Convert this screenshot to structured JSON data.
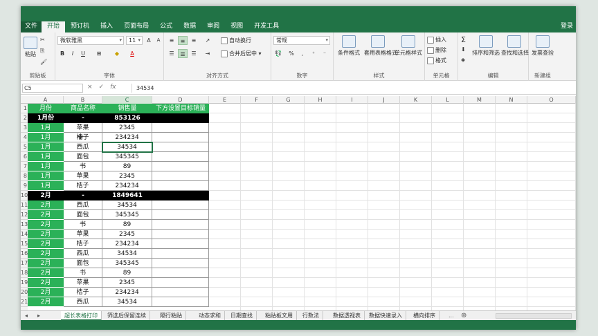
{
  "ribbon_tabs": [
    {
      "label": "文件",
      "state": "file"
    },
    {
      "label": "开始",
      "state": "active"
    },
    {
      "label": "预订机",
      "state": ""
    },
    {
      "label": "插入",
      "state": ""
    },
    {
      "label": "页面布局",
      "state": ""
    },
    {
      "label": "公式",
      "state": ""
    },
    {
      "label": "数据",
      "state": ""
    },
    {
      "label": "审阅",
      "state": ""
    },
    {
      "label": "视图",
      "state": ""
    },
    {
      "label": "开发工具",
      "state": ""
    }
  ],
  "login_label": "登录",
  "ribbon": {
    "clipboard": {
      "paste": "粘贴",
      "group": "剪贴板"
    },
    "font": {
      "name": "微软雅黑",
      "size": "11",
      "bold": "B",
      "italic": "I",
      "underline": "U",
      "grow": "A",
      "shrink": "A",
      "color": "A",
      "group": "字体"
    },
    "align": {
      "wrap": "自动换行",
      "merge": "合并后居中",
      "group": "对齐方式"
    },
    "number": {
      "format": "常规",
      "percent": "%",
      "comma": ",",
      "group": "数字"
    },
    "styles": {
      "conditional": "条件格式",
      "table": "套用表格格式",
      "cell": "单元格样式",
      "group": "样式"
    },
    "cells": {
      "insert": "插入",
      "delete": "删除",
      "format": "格式",
      "group": "单元格"
    },
    "editing": {
      "sum": "Σ",
      "sort": "排序和筛选",
      "find": "查找和选择",
      "group": "编辑"
    },
    "newgroup": {
      "invoice": "发票查验",
      "group": "新建组"
    }
  },
  "formula_bar": {
    "name_box": "C5",
    "cancel": "×",
    "enter": "✓",
    "fx": "fx",
    "value": "34534"
  },
  "columns": [
    "A",
    "B",
    "C",
    "D",
    "E",
    "F",
    "G",
    "H",
    "I",
    "J",
    "K",
    "L",
    "M",
    "N",
    "O"
  ],
  "header_row": {
    "a": "月份",
    "b": "商品名称",
    "c": "销售量",
    "d": "下方设置目标销量"
  },
  "rows": [
    {
      "n": "2",
      "a": "1月份",
      "b": "-",
      "c": "853126",
      "type": "subtotal"
    },
    {
      "n": "3",
      "a": "1月",
      "b": "苹果",
      "c": "2345",
      "type": "data"
    },
    {
      "n": "4",
      "a": "1月",
      "b": "桔子",
      "c": "234234",
      "type": "data"
    },
    {
      "n": "5",
      "a": "1月",
      "b": "西瓜",
      "c": "34534",
      "type": "data"
    },
    {
      "n": "6",
      "a": "1月",
      "b": "面包",
      "c": "345345",
      "type": "data"
    },
    {
      "n": "7",
      "a": "1月",
      "b": "书",
      "c": "89",
      "type": "data"
    },
    {
      "n": "8",
      "a": "1月",
      "b": "苹果",
      "c": "2345",
      "type": "data"
    },
    {
      "n": "9",
      "a": "1月",
      "b": "桔子",
      "c": "234234",
      "type": "data"
    },
    {
      "n": "10",
      "a": "2月",
      "b": "-",
      "c": "1849641",
      "type": "subtotal"
    },
    {
      "n": "11",
      "a": "2月",
      "b": "西瓜",
      "c": "34534",
      "type": "data"
    },
    {
      "n": "12",
      "a": "2月",
      "b": "面包",
      "c": "345345",
      "type": "data"
    },
    {
      "n": "13",
      "a": "2月",
      "b": "书",
      "c": "89",
      "type": "data"
    },
    {
      "n": "14",
      "a": "2月",
      "b": "苹果",
      "c": "2345",
      "type": "data"
    },
    {
      "n": "15",
      "a": "2月",
      "b": "桔子",
      "c": "234234",
      "type": "data"
    },
    {
      "n": "16",
      "a": "2月",
      "b": "西瓜",
      "c": "34534",
      "type": "data"
    },
    {
      "n": "17",
      "a": "2月",
      "b": "面包",
      "c": "345345",
      "type": "data"
    },
    {
      "n": "18",
      "a": "2月",
      "b": "书",
      "c": "89",
      "type": "data"
    },
    {
      "n": "19",
      "a": "2月",
      "b": "苹果",
      "c": "2345",
      "type": "data"
    },
    {
      "n": "20",
      "a": "2月",
      "b": "桔子",
      "c": "234234",
      "type": "data"
    },
    {
      "n": "21",
      "a": "2月",
      "b": "西瓜",
      "c": "34534",
      "type": "data"
    }
  ],
  "selected_cell": "C5",
  "sheet_tabs": [
    {
      "label": "超长表格打印",
      "active": true
    },
    {
      "label": "筛选后保留连续",
      "active": false
    },
    {
      "label": "隔行粘贴",
      "active": false
    },
    {
      "label": "动态求和",
      "active": false
    },
    {
      "label": "日期查找",
      "active": false
    },
    {
      "label": "粘贴板文用",
      "active": false
    },
    {
      "label": "行数法",
      "active": false
    },
    {
      "label": "数据透视表",
      "active": false
    },
    {
      "label": "数据快速录入",
      "active": false
    },
    {
      "label": "横向排序",
      "active": false
    }
  ],
  "sheet_more": "...",
  "add_sheet": "⊕",
  "colors": {
    "accent": "#217346",
    "green_cell": "#2bb158",
    "subtotal": "#000000"
  }
}
